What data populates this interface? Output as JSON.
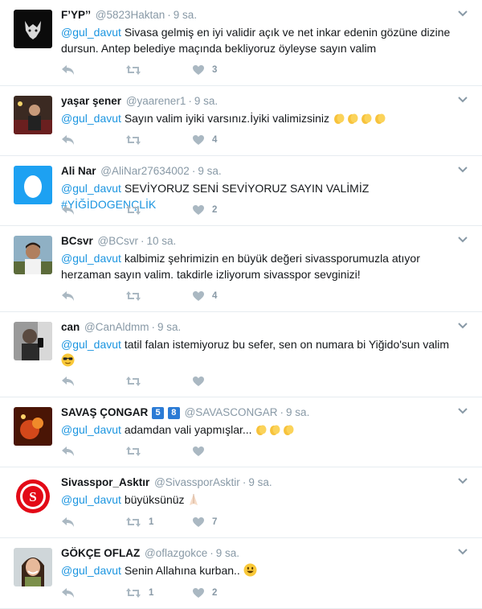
{
  "colors": {
    "link": "#1b95e0",
    "meta": "#8899a6",
    "divider": "#e6ecf0"
  },
  "tweets": [
    {
      "name": "F’YP’’",
      "handle": "@5823Haktan",
      "time": "9 sa.",
      "mention": "@gul_davut",
      "text": "Sivasa gelmiş en iyi validir açık ve net inkar edenin gözüne dizine dursun. Antep belediye maçında bekliyoruz öyleyse sayın valim",
      "retweets": "",
      "likes": "3",
      "avatar_icon": "wolf-avatar"
    },
    {
      "name": "yaşar şener",
      "handle": "@yaarener1",
      "time": "9 sa.",
      "mention": "@gul_davut",
      "text": "Sayın valim iyiki varsınız.İyiki valimizsiniz",
      "emoji": [
        "clapping-hands-emoji",
        "clapping-hands-emoji",
        "clapping-hands-emoji",
        "clapping-hands-emoji"
      ],
      "retweets": "",
      "likes": "4",
      "avatar_icon": "photo-avatar"
    },
    {
      "name": "Ali Nar",
      "handle": "@AliNar27634002",
      "time": "9 sa.",
      "mention": "@gul_davut",
      "text": "SEVİYORUZ SENİ SEVİYORUZ SAYIN VALİMİZ",
      "hashtag": "#YİĞİDOGENÇLİK",
      "retweets": "",
      "likes": "2",
      "avatar_icon": "egg-avatar"
    },
    {
      "name": "BCsvr",
      "handle": "@BCsvr",
      "time": "10 sa.",
      "mention": "@gul_davut",
      "text": "kalbimiz şehrimizin en büyük değeri sivassporumuzla atıyor herzaman sayın valim. takdirle izliyorum sivasspor sevginizi!",
      "retweets": "",
      "likes": "4",
      "avatar_icon": "photo-avatar"
    },
    {
      "name": "can",
      "handle": "@CanAldmm",
      "time": "9 sa.",
      "mention": "@gul_davut",
      "text": "tatil falan istemiyoruz bu sefer, sen on numara bi Yiğido'sun valim",
      "emoji": [
        "sunglasses-face-emoji"
      ],
      "retweets": "",
      "likes": "",
      "avatar_icon": "photo-avatar"
    },
    {
      "name": "SAVAŞ ÇONGAR",
      "badges": [
        "5",
        "8"
      ],
      "handle": "@SAVASCONGAR",
      "time": "9 sa.",
      "mention": "@gul_davut",
      "text": "adamdan vali yapmışlar...",
      "emoji": [
        "clapping-hands-emoji",
        "clapping-hands-emoji",
        "clapping-hands-emoji"
      ],
      "retweets": "",
      "likes": "",
      "avatar_icon": "photo-avatar"
    },
    {
      "name": "Sivasspor_Asktır",
      "handle": "@SivassporAsktir",
      "time": "9 sa.",
      "mention": "@gul_davut",
      "text": "büyüksünüz",
      "emoji": [
        "praying-hands-emoji"
      ],
      "retweets": "1",
      "likes": "7",
      "avatar_icon": "club-logo-avatar"
    },
    {
      "name": "GÖKÇE OFLAZ",
      "handle": "@oflazgokce",
      "time": "9 sa.",
      "mention": "@gul_davut",
      "text": "Senin Allahına kurban..",
      "emoji": [
        "smiling-face-emoji"
      ],
      "retweets": "1",
      "likes": "2",
      "avatar_icon": "photo-avatar"
    }
  ]
}
